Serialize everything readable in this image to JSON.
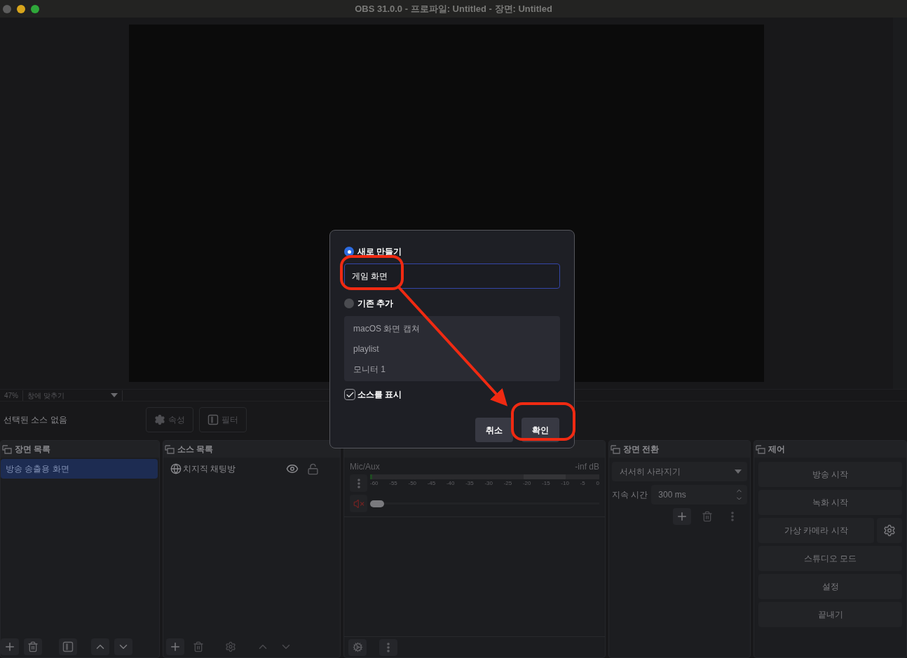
{
  "window": {
    "title": "OBS 31.0.0 - 프로파일: Untitled - 장면: Untitled"
  },
  "preview": {
    "zoom": "47%",
    "scale_mode": "창에 맞추기"
  },
  "context_bar": {
    "label": "선택된 소스 없음",
    "buttons": [
      {
        "label": "속성",
        "kind": "settings"
      },
      {
        "label": "필터",
        "kind": "filter"
      }
    ]
  },
  "scenes": {
    "title": "장면 목록",
    "items": [
      {
        "label": "방송 송출용 화면",
        "selected": true
      }
    ]
  },
  "sources": {
    "title": "소스 목록",
    "items": [
      {
        "label": "치지직 채팅방",
        "visible": true,
        "locked": false
      }
    ]
  },
  "mixer": {
    "channels": [
      {
        "name": "Mic/Aux",
        "reading": "-inf dB",
        "muted": true,
        "level": 0,
        "ticks": [
          "-60",
          "-55",
          "-50",
          "-45",
          "-40",
          "-35",
          "-30",
          "-25",
          "-20",
          "-15",
          "-10",
          "-5",
          "0"
        ]
      }
    ]
  },
  "transitions": {
    "title": "장면 전환",
    "transition": "서서히 사라지기",
    "duration_label": "지속 시간",
    "duration": "300 ms"
  },
  "controls": {
    "title": "제어",
    "buttons": [
      {
        "label": "방송 시작",
        "settings": false
      },
      {
        "label": "녹화 시작",
        "settings": false
      },
      {
        "label": "가상 카메라 시작",
        "settings": true
      },
      {
        "label": "스튜디오 모드",
        "settings": false
      },
      {
        "label": "설정",
        "settings": false
      },
      {
        "label": "끝내기",
        "settings": false
      }
    ]
  },
  "dialog": {
    "options": [
      {
        "label": "새로 만들기",
        "selected": true
      },
      {
        "label": "기존 추가",
        "selected": false
      }
    ],
    "name_value": "게임 화면",
    "existing_items": [
      "macOS 화면 캡쳐",
      "playlist",
      "모니터 1"
    ],
    "show_source": {
      "label": "소스를 표시",
      "checked": true
    },
    "buttons": [
      "취소",
      "확인"
    ]
  }
}
